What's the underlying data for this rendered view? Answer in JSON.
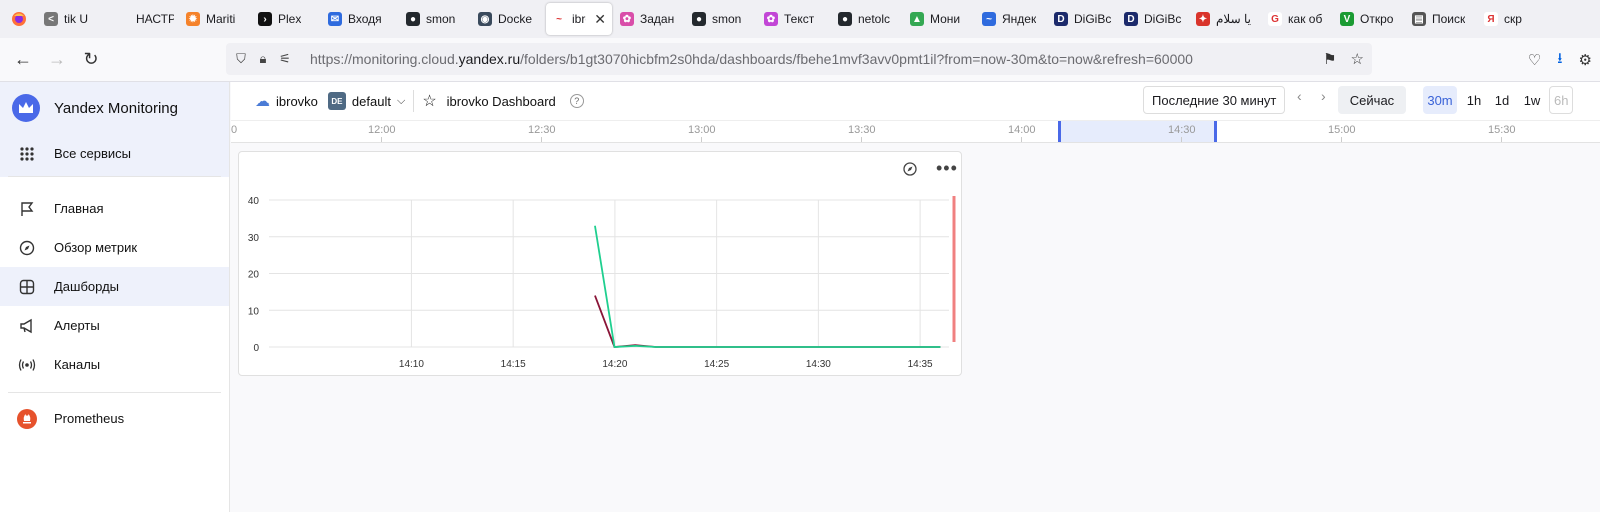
{
  "browser": {
    "tabs": [
      {
        "label": "tik U",
        "color": "#777777",
        "glyph": "<"
      },
      {
        "label": "НАСТРОЙ",
        "color": "#f0f0f4",
        "glyph": ""
      },
      {
        "label": "Mariti",
        "color": "#f5822a",
        "glyph": "✹"
      },
      {
        "label": "Plex",
        "color": "#111111",
        "glyph": "›"
      },
      {
        "label": "Входя",
        "color": "#2f6bde",
        "glyph": "✉"
      },
      {
        "label": "smon",
        "color": "#24292e",
        "glyph": "●"
      },
      {
        "label": "Docke",
        "color": "#3a4a5c",
        "glyph": "◉"
      },
      {
        "label": "ibro",
        "color": "#ffffff",
        "glyph": "~",
        "active": true
      },
      {
        "label": "Задан",
        "color": "#d94ea9",
        "glyph": "✿"
      },
      {
        "label": "smon",
        "color": "#24292e",
        "glyph": "●"
      },
      {
        "label": "Текст",
        "color": "#c246d6",
        "glyph": "✿"
      },
      {
        "label": "netolc",
        "color": "#24292e",
        "glyph": "●"
      },
      {
        "label": "Мони",
        "color": "#34a853",
        "glyph": "▲"
      },
      {
        "label": "Яндек",
        "color": "#2f6bde",
        "glyph": "~"
      },
      {
        "label": "DiGiBc",
        "color": "#1c2a6b",
        "glyph": "D"
      },
      {
        "label": "DiGiBc",
        "color": "#1c2a6b",
        "glyph": "D"
      },
      {
        "label": "يا سلام",
        "color": "#d9342b",
        "glyph": "✦"
      },
      {
        "label": "как об",
        "color": "#ffffff",
        "glyph": "G"
      },
      {
        "label": "Откро",
        "color": "#1b9b33",
        "glyph": "V"
      },
      {
        "label": "Поиск",
        "color": "#555555",
        "glyph": "▤"
      },
      {
        "label": "скр",
        "color": "#ffffff",
        "glyph": "Я"
      }
    ],
    "url_prefix": "https://monitoring.cloud.",
    "url_domain": "yandex.ru",
    "url_rest": "/folders/b1gt3070hicbfm2s0hda/dashboards/fbehe1mvf3avv0pmt1il?from=now-30m&to=now&refresh=60000"
  },
  "sidebar": {
    "brand": "Yandex Monitoring",
    "all_services": "Все сервисы",
    "items": [
      {
        "label": "Главная",
        "icon": "flag-icon"
      },
      {
        "label": "Обзор метрик",
        "icon": "compass-icon"
      },
      {
        "label": "Дашборды",
        "icon": "dashboard-icon",
        "active": true
      },
      {
        "label": "Алерты",
        "icon": "megaphone-icon"
      },
      {
        "label": "Каналы",
        "icon": "broadcast-icon"
      }
    ],
    "prometheus": "Prometheus"
  },
  "dashboard": {
    "cloud": "ibrovko",
    "folder_badge": "DE",
    "folder": "default",
    "title": "ibrovko Dashboard",
    "help": "?",
    "range": "Последние 30 минут",
    "now": "Сейчас",
    "zooms": [
      "30m",
      "1h",
      "1d",
      "1w",
      "6h"
    ]
  },
  "ruler": {
    "labels": [
      "12:00",
      "12:30",
      "13:00",
      "13:30",
      "14:00",
      "14:30",
      "15:00",
      "15:30"
    ],
    "lead": "0"
  },
  "chart_data": {
    "type": "line",
    "x": [
      "14:10",
      "14:15",
      "14:20",
      "14:25",
      "14:30",
      "14:35"
    ],
    "ylim": [
      0,
      40
    ],
    "yticks": [
      0,
      10,
      20,
      30,
      40
    ],
    "xlim_minutes": [
      14.05,
      14.607
    ],
    "series": [
      {
        "color": "#1fcf8f",
        "points": [
          [
            14.317,
            33
          ],
          [
            14.333,
            0
          ],
          [
            14.35,
            0.3
          ],
          [
            14.367,
            0
          ],
          [
            14.6,
            0
          ]
        ]
      },
      {
        "color": "#8a1538",
        "points": [
          [
            14.317,
            14
          ],
          [
            14.333,
            0
          ],
          [
            14.35,
            0.5
          ],
          [
            14.367,
            0
          ],
          [
            14.6,
            0
          ]
        ]
      }
    ],
    "now_marker_color": "#f08080"
  }
}
